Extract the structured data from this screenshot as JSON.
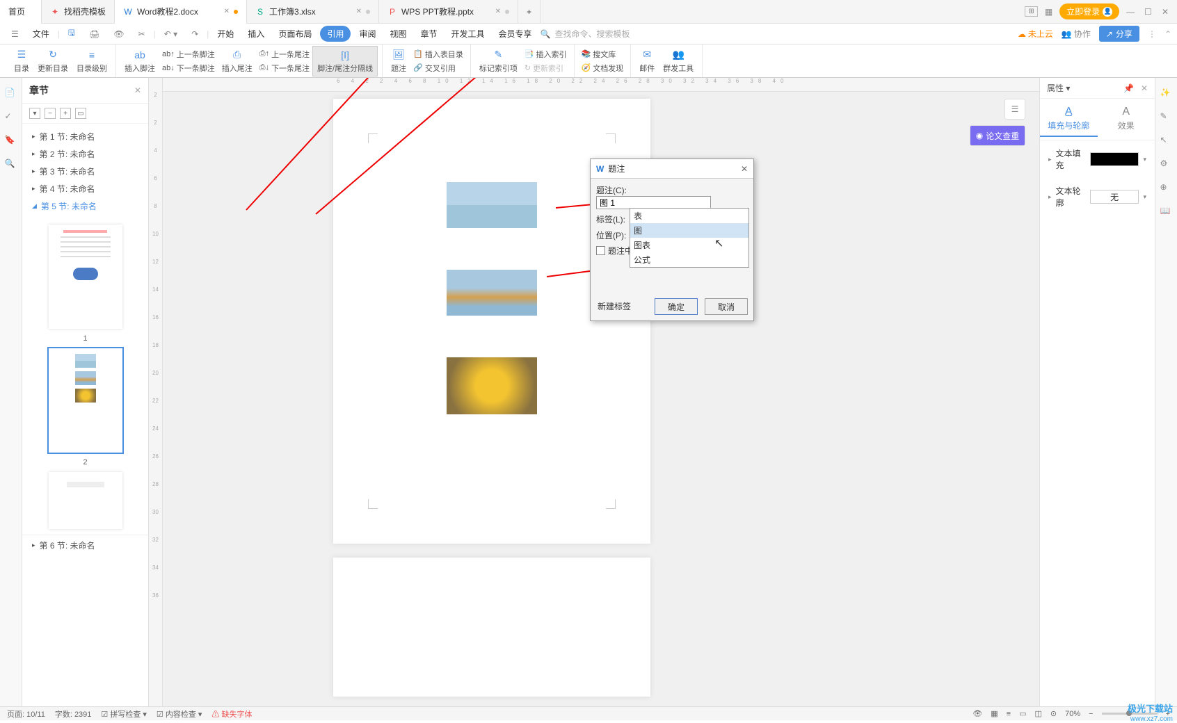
{
  "tabs": {
    "home": "首页",
    "template": "找稻壳模板",
    "word_doc": "Word教程2.docx",
    "workbook": "工作簿3.xlsx",
    "ppt": "WPS PPT教程.pptx",
    "login": "立即登录"
  },
  "menu": {
    "file": "文件",
    "items": [
      "开始",
      "插入",
      "页面布局",
      "引用",
      "审阅",
      "视图",
      "章节",
      "开发工具",
      "会员专享"
    ],
    "active_index": 3,
    "search_placeholder": "查找命令、搜索模板",
    "not_cloud": "未上云",
    "collab": "协作",
    "share": "分享"
  },
  "ribbon": {
    "toc": "目录",
    "update_toc": "更新目录",
    "toc_level": "目录级别",
    "insert_footnote": "插入脚注",
    "prev_footnote": "上一条脚注",
    "next_footnote": "下一条脚注",
    "insert_endnote": "插入尾注",
    "prev_endnote": "上一条尾注",
    "next_endnote": "下一条尾注",
    "separator": "脚注/尾注分隔线",
    "caption": "题注",
    "cross_ref": "交叉引用",
    "insert_fig_toc": "插入表目录",
    "mark_entry": "标记索引项",
    "insert_index": "插入索引",
    "update_index": "更新索引",
    "search_lib": "搜文库",
    "doc_disc": "文档发现",
    "mail": "邮件",
    "group_send": "群发工具"
  },
  "sidebar": {
    "title": "章节",
    "sections": [
      "第 1 节: 未命名",
      "第 2 节: 未命名",
      "第 3 节: 未命名",
      "第 4 节: 未命名",
      "第 5 节: 未命名"
    ],
    "active_section": 4,
    "thumbs": [
      "1",
      "2"
    ],
    "footer_section": "第 6 节: 未命名"
  },
  "editor": {
    "float_label": "论文查重",
    "hruler_ticks": "6 4 2  2 4 6 8 10 12 14 16 18 20 22 24 26 28 30 32 34 36 38 40",
    "vruler_ticks": [
      "2",
      "2",
      "4",
      "6",
      "8",
      "10",
      "12",
      "14",
      "16",
      "18",
      "20",
      "22",
      "24",
      "26",
      "28",
      "30",
      "32",
      "34",
      "36"
    ]
  },
  "dialog": {
    "title": "题注",
    "caption_label": "题注(C):",
    "caption_value": "图 1",
    "tag_label": "标签(L):",
    "tag_value": "图",
    "pos_label": "位置(P):",
    "checkbox_label": "题注中",
    "new_tag": "新建标签",
    "dropdown": [
      "表",
      "图",
      "图表",
      "公式"
    ],
    "dropdown_hl": 1,
    "ok": "确定",
    "cancel": "取消"
  },
  "right_panel": {
    "title": "属性",
    "tab1": "填充与轮廓",
    "tab2": "效果",
    "text_fill": "文本填充",
    "text_outline": "文本轮廓",
    "outline_value": "无"
  },
  "status": {
    "page": "页面: 10/11",
    "words": "字数: 2391",
    "spell": "拼写检查",
    "content": "内容检查",
    "missing_font": "缺失字体",
    "zoom": "70%"
  },
  "watermark": {
    "brand": "极光下载站",
    "url": "www.xz7.com"
  }
}
